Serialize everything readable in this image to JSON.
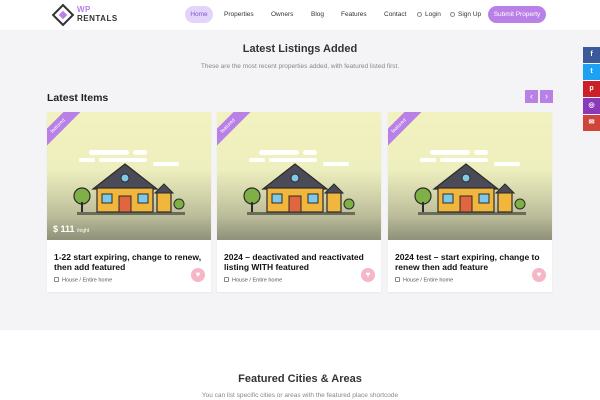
{
  "header": {
    "logo_top": "WP",
    "logo_bottom": "RENTALS",
    "nav": {
      "home": "Home",
      "properties": "Properties",
      "owners": "Owners",
      "blog": "Blog",
      "features": "Features",
      "contact": "Contact",
      "login": "Login",
      "signup": "Sign Up",
      "submit": "Submit Property"
    }
  },
  "latest": {
    "title": "Latest Listings Added",
    "subtitle": "These are the most recent properties added, with featured listed first.",
    "items_heading": "Latest Items",
    "prev_icon": "‹",
    "next_icon": "›"
  },
  "cards": [
    {
      "ribbon": "featured",
      "price": "$ 111",
      "price_unit": "/night",
      "title": "1-22 start expiring, change to renew, then add featured",
      "meta": "House / Entire home"
    },
    {
      "ribbon": "featured",
      "title": "2024 – deactivated and reactivated listing WITH featured",
      "meta": "House / Entire home"
    },
    {
      "ribbon": "featured",
      "title": "2024 test – start expiring, change to renew then add feature",
      "meta": "House / Entire home"
    }
  ],
  "featured_cities": {
    "title": "Featured Cities & Areas",
    "subtitle": "You can list specific cities or areas with the featured place shortcode"
  },
  "social": {
    "facebook": "f",
    "twitter": "t",
    "pinterest": "p",
    "instagram": "◎",
    "email": "✉"
  },
  "colors": {
    "accent": "#b981e8",
    "facebook": "#3b5998",
    "twitter": "#1da1f2",
    "pinterest": "#cb2027",
    "instagram": "#8a3ab9",
    "email": "#d0453a"
  }
}
